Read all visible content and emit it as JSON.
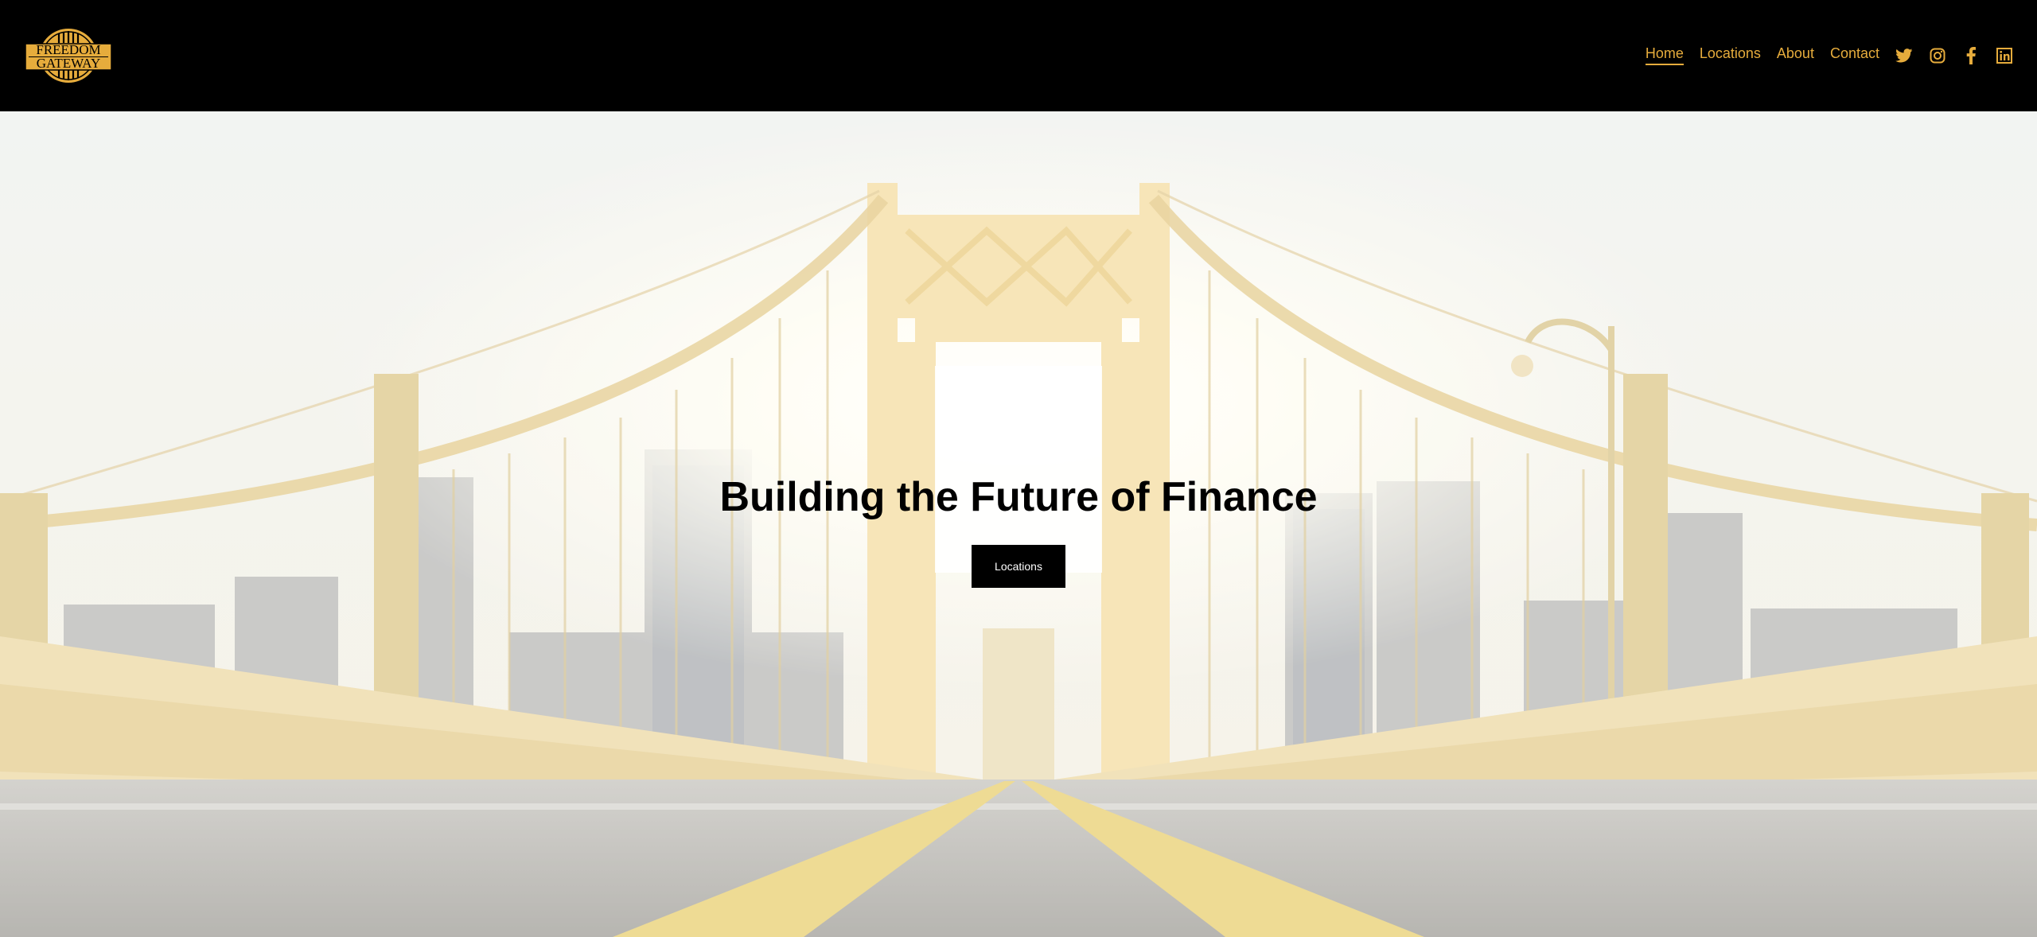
{
  "brand": {
    "line1": "FREEDOM",
    "line2": "GATEWAY",
    "color": "#e6ac3c"
  },
  "nav": {
    "items": [
      {
        "label": "Home",
        "active": true
      },
      {
        "label": "Locations"
      },
      {
        "label": "About"
      },
      {
        "label": "Contact"
      }
    ],
    "social": [
      "twitter-icon",
      "instagram-icon",
      "facebook-icon",
      "linkedin-icon"
    ]
  },
  "hero": {
    "title": "Building the Future of Finance",
    "button": "Locations"
  },
  "colors": {
    "accent": "#e6ac3c",
    "header_bg": "#000000",
    "button_bg": "#000000"
  }
}
